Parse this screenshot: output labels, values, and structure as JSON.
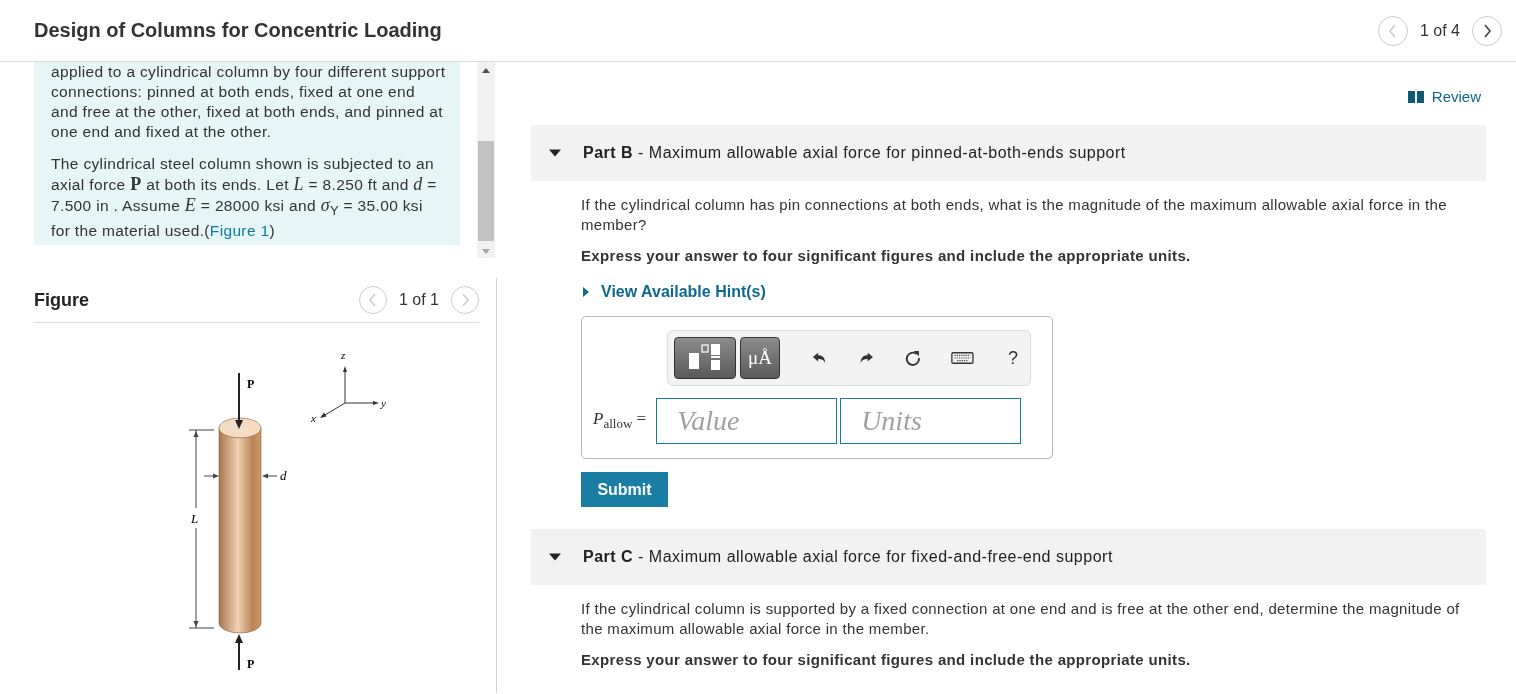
{
  "header": {
    "title": "Design of Columns for Concentric Loading",
    "pager": "1 of 4"
  },
  "problem": {
    "paragraphs": [
      {
        "text": "applied to a cylindrical column by four different support connections: pinned at both ends, fixed at one end and free at the other, fixed at both ends, and pinned at one end and fixed at the other."
      },
      {
        "text": "The cylindrical steel column shown is subjected to an axial force **P** at both its ends. Let *L* = 8.250 ft and *d* = 7.500 in . Assume *E* = 28000 ksi and *σ*$_{Y}$ = 35.00 ksi for the material used.",
        "link_before": "(",
        "link": "Figure 1",
        "link_after": ")"
      }
    ]
  },
  "figure": {
    "title": "Figure",
    "pager": "1 of 1",
    "labels": {
      "force_top": "P",
      "force_bottom": "P",
      "length": "L",
      "diameter": "d",
      "axis_x": "x",
      "axis_y": "y",
      "axis_z": "z"
    }
  },
  "review": "Review",
  "parts": [
    {
      "title": "**Part B** - Maximum allowable axial force for pinned-at-both-ends support",
      "expanded": true,
      "question": "If the cylindrical column has pin connections at both ends, what is the magnitude of the maximum allowable axial force in the member?",
      "instruction": "Express your answer to four significant figures and include the appropriate units.",
      "hint": {
        "label": "View Available Hint(s)",
        "expanded": false
      },
      "answer": {
        "symbol": "P",
        "subscript": "allow",
        "equals": "=",
        "value_placeholder": "Value",
        "units_placeholder": "Units",
        "toolbar": {
          "units_button": "μÅ",
          "help": "?"
        }
      },
      "submit": "Submit"
    },
    {
      "title": "**Part C** - Maximum allowable axial force for fixed-and-free-end support",
      "expanded": true,
      "question": "If the cylindrical column is supported by a fixed connection at one end and is free at the other end, determine the magnitude of the maximum allowable axial force in the member.",
      "instruction": "Express your answer to four significant figures and include the appropriate units."
    }
  ]
}
